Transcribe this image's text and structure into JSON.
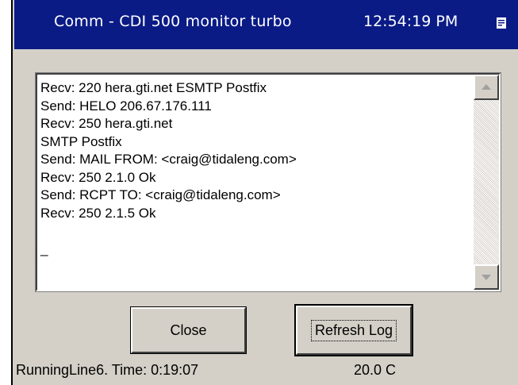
{
  "window": {
    "title": "Comm - CDI 500 monitor turbo",
    "time": "12:54:19 PM",
    "icon": "window-menu-icon"
  },
  "log": {
    "lines": [
      "Recv: 220 hera.gti.net ESMTP Postfix",
      "Send: HELO 206.67.176.111",
      "Recv: 250 hera.gti.net",
      "SMTP Postfix",
      "Send: MAIL FROM: <craig@tidaleng.com>",
      "Recv: 250 2.1.0 Ok",
      "Send: RCPT TO: <craig@tidaleng.com>",
      "Recv: 250 2.1.5 Ok",
      "",
      "_"
    ]
  },
  "buttons": {
    "close": "Close",
    "refresh": "Refresh Log"
  },
  "status": {
    "left": "RunningLine6.  Time: 0:19:07",
    "temp": "20.0 C"
  },
  "colors": {
    "titlebar": "#0a1b86",
    "face": "#d4d0c8"
  }
}
